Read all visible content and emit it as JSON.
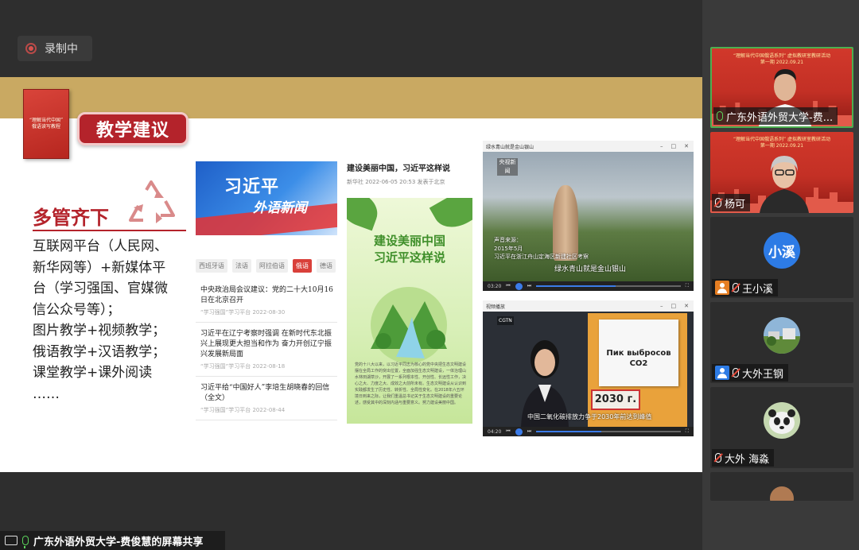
{
  "recording": {
    "label": "录制中"
  },
  "slide": {
    "book_title": "“理解当代中国” 俄语读写教程",
    "topic_title": "教学建议",
    "left_heading": "多管齐下",
    "bullets": [
      "互联网平台（人民网、",
      "新华网等）+新媒体平",
      "台（学习强国、官媒微",
      "信公众号等）；",
      "图片教学+视频教学；",
      "俄语教学+汉语教学；",
      "课堂教学+课外阅读",
      "……"
    ],
    "news_panel": {
      "banner_line1": "习近平",
      "banner_line2": "外语新闻",
      "tabs": [
        "西班牙语",
        "法语",
        "阿拉伯语",
        "俄语",
        "德语"
      ],
      "active_tab": "俄语",
      "items": [
        {
          "title": "中央政治局会议建议：党的二十大10月16日在北京召开",
          "meta": "“学习强国”学习平台  2022-08-30"
        },
        {
          "title": "习近平在辽宁考察时强调 在新时代东北振兴上展现更大担当和作为 奋力开创辽宁振兴发展新局面",
          "meta": "“学习强国”学习平台  2022-08-18"
        },
        {
          "title": "习近平给“中国好人”李培生胡晓春的回信（全文）",
          "meta": "“学习强国”学习平台  2022-08-44"
        }
      ]
    },
    "article_panel": {
      "title": "建设美丽中国，习近平这样说",
      "meta": "新华社  2022-06-05 20:53  发表于北京",
      "image_title_line1": "建设美丽中国",
      "image_title_line2": "习近平这样说",
      "body": "党的十八大以来，以习近平同志为核心的党中央把生态文明建设摆在全局工作的突出位置，全面加强生态文明建设，一体治理山水林田湖草沙，开展了一系列根本性、开创性、长远性工作，决心之大、力度之大、成效之大前所未有。生态文明建设从认识到实践都发生了历史性、转折性、全局性变化。在2018年六五环境日到来之际，让我们重温总书记关于生态文明建设的重要论述，感受其中的深刻内涵与重要意义。努力建设美丽中国。"
    },
    "video1": {
      "window_title": "绿水青山就是金山银山",
      "logo": "央视新闻",
      "source": "声音来源：\n2015年5月\n习近平在浙江舟山定海区新建社区考察",
      "caption": "绿水青山就是金山银山",
      "time": "03:20",
      "progress": 0.55
    },
    "video2": {
      "window_title": "视频播放",
      "channel": "CGTN",
      "card_text_line1": "Пик выбросов",
      "card_text_line2": "CO2",
      "card_year": "2030 г.",
      "subtitle": "中国二氧化碳排放力争于2030年前达到峰值",
      "time": "04:20",
      "progress": 0.45
    }
  },
  "bottom_bar": {
    "label": "广东外语外贸大学-费俊慧的屏幕共享"
  },
  "participants": [
    {
      "name": "广东外语外贸大学-费...",
      "muted": false,
      "type": "video",
      "headline": "“理解当代中国俄语系列” 虚拟教研室教研活动\n第一期 2022.09.21"
    },
    {
      "name": "杨可",
      "muted": true,
      "type": "video",
      "headline": "“理解当代中国俄语系列” 虚拟教研室教研活动\n第一期 2022.09.21"
    },
    {
      "name": "王小溪",
      "muted": true,
      "type": "initial",
      "initial": "小溪",
      "icon_color": "#e67e22"
    },
    {
      "name": "大外王钢",
      "muted": true,
      "type": "photo",
      "icon_color": "#2d7be5"
    },
    {
      "name": "大外 海淼",
      "muted": true,
      "type": "panda"
    }
  ]
}
